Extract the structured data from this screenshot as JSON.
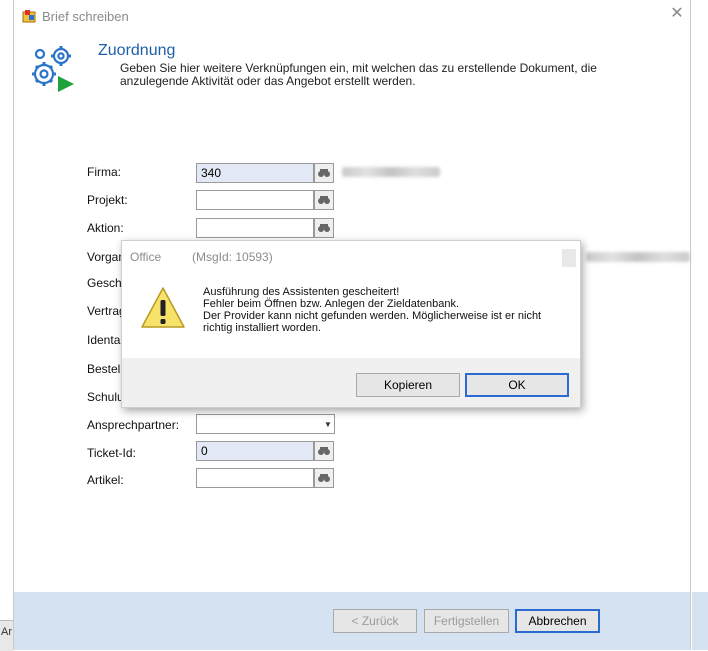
{
  "window": {
    "title": "Brief schreiben",
    "close_icon": "✕"
  },
  "header": {
    "section_title": "Zuordnung",
    "description": "Geben Sie hier weitere Verknüpfungen ein, mit welchen das zu erstellende Dokument, die anzulegende Aktivität oder das Angebot erstellt werden."
  },
  "fields": {
    "firma": {
      "label": "Firma:",
      "value": "340"
    },
    "projekt": {
      "label": "Projekt:",
      "value": ""
    },
    "aktion": {
      "label": "Aktion:",
      "value": ""
    },
    "vorgang": {
      "label": "Vorgan",
      "value": ""
    },
    "geschaeft": {
      "label": "Gescha",
      "value": ""
    },
    "vertrag": {
      "label": "Vertrag",
      "value": ""
    },
    "identar": {
      "label": "Identar",
      "value": ""
    },
    "bestell": {
      "label": "Bestell",
      "value": ""
    },
    "schulung": {
      "label": "Schulu",
      "value": ""
    },
    "ansprechpartner": {
      "label": "Ansprechpartner:",
      "value": ""
    },
    "ticket_id": {
      "label": "Ticket-Id:",
      "value": "0"
    },
    "artikel": {
      "label": "Artikel:",
      "value": ""
    }
  },
  "buttons": {
    "back": "< Zurück",
    "finish": "Fertigstellen",
    "cancel": "Abbrechen"
  },
  "message_box": {
    "title": "Office",
    "msg_id": "(MsgId: 10593)",
    "text_lines": [
      "Ausführung des Assistenten gescheitert!",
      "Fehler beim Öffnen bzw. Anlegen der Zieldatenbank.",
      "Der Provider kann nicht gefunden werden.  Möglicherweise ist er nicht",
      "richtig installiert worden."
    ],
    "copy_button": "Kopieren",
    "ok_button": "OK"
  },
  "background": {
    "taskbar_text": "Ar"
  },
  "colors": {
    "accent": "#1f5fa8",
    "filled_field": "#e3e8f6",
    "footer": "#d4e2f1",
    "gear_blue": "#2a73c9",
    "play_green": "#1fa23a",
    "warning_yellow": "#f7e26a"
  }
}
